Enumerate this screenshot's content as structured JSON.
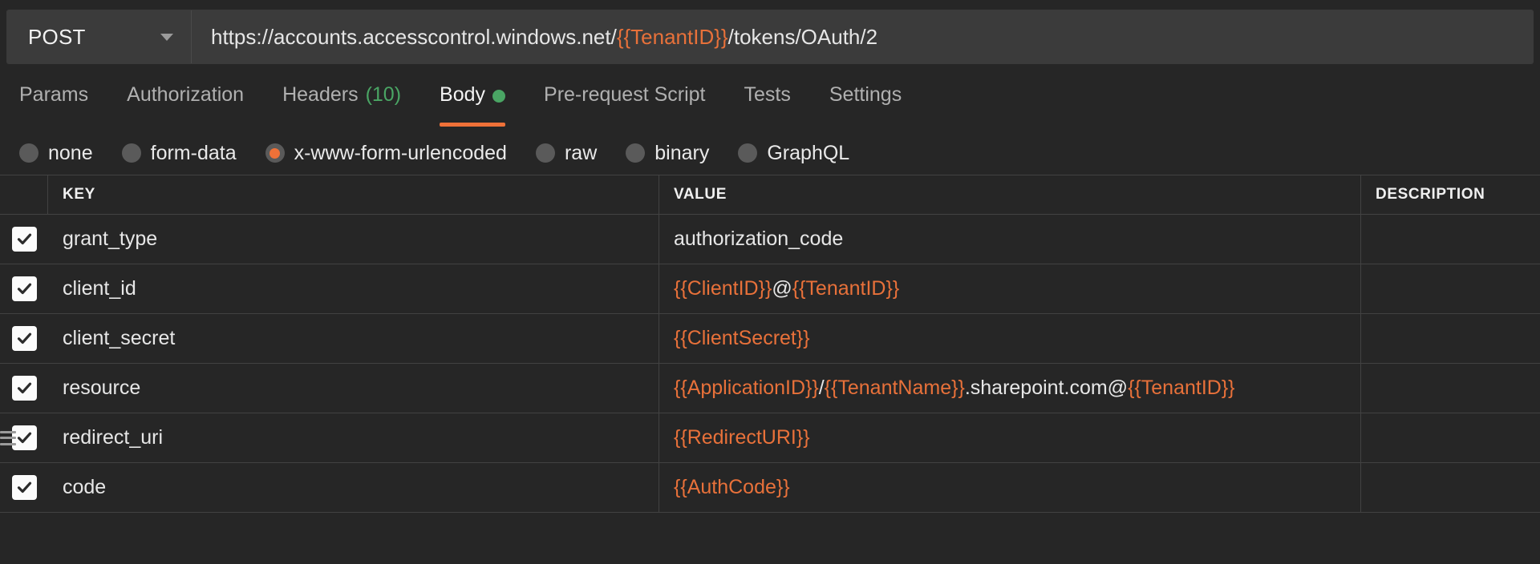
{
  "request": {
    "method": "POST",
    "method_caret_icon": "chevron-down-icon",
    "url_segments": [
      {
        "text": "https://accounts.accesscontrol.windows.net/",
        "variable": false
      },
      {
        "text": "{{TenantID}}",
        "variable": true
      },
      {
        "text": "/tokens/OAuth/2",
        "variable": false
      }
    ],
    "url_full": "https://accounts.accesscontrol.windows.net/{{TenantID}}/tokens/OAuth/2"
  },
  "tabs": [
    {
      "label": "Params",
      "active": false,
      "count": null,
      "dot": false
    },
    {
      "label": "Authorization",
      "active": false,
      "count": null,
      "dot": false
    },
    {
      "label": "Headers",
      "active": false,
      "count": "(10)",
      "dot": false
    },
    {
      "label": "Body",
      "active": true,
      "count": null,
      "dot": true
    },
    {
      "label": "Pre-request Script",
      "active": false,
      "count": null,
      "dot": false
    },
    {
      "label": "Tests",
      "active": false,
      "count": null,
      "dot": false
    },
    {
      "label": "Settings",
      "active": false,
      "count": null,
      "dot": false
    }
  ],
  "body_types": [
    {
      "label": "none",
      "selected": false
    },
    {
      "label": "form-data",
      "selected": false
    },
    {
      "label": "x-www-form-urlencoded",
      "selected": true
    },
    {
      "label": "raw",
      "selected": false
    },
    {
      "label": "binary",
      "selected": false
    },
    {
      "label": "GraphQL",
      "selected": false
    }
  ],
  "table": {
    "columns": [
      "KEY",
      "VALUE",
      "DESCRIPTION"
    ],
    "rows": [
      {
        "checked": true,
        "drag_handle": false,
        "key": "grant_type",
        "value_segments": [
          {
            "text": "authorization_code",
            "variable": false
          }
        ],
        "value_full": "authorization_code",
        "description": ""
      },
      {
        "checked": true,
        "drag_handle": false,
        "key": "client_id",
        "value_segments": [
          {
            "text": "{{ClientID}}",
            "variable": true
          },
          {
            "text": "@",
            "variable": false
          },
          {
            "text": "{{TenantID}}",
            "variable": true
          }
        ],
        "value_full": "{{ClientID}}@{{TenantID}}",
        "description": ""
      },
      {
        "checked": true,
        "drag_handle": false,
        "key": "client_secret",
        "value_segments": [
          {
            "text": "{{ClientSecret}}",
            "variable": true
          }
        ],
        "value_full": "{{ClientSecret}}",
        "description": ""
      },
      {
        "checked": true,
        "drag_handle": false,
        "key": "resource",
        "value_segments": [
          {
            "text": "{{ApplicationID}}",
            "variable": true
          },
          {
            "text": "/",
            "variable": false
          },
          {
            "text": "{{TenantName}}",
            "variable": true
          },
          {
            "text": ".sharepoint.com@",
            "variable": false
          },
          {
            "text": "{{TenantID}}",
            "variable": true
          }
        ],
        "value_full": "{{ApplicationID}}/{{TenantName}}.sharepoint.com@{{TenantID}}",
        "description": ""
      },
      {
        "checked": true,
        "drag_handle": true,
        "key": "redirect_uri",
        "value_segments": [
          {
            "text": "{{RedirectURI}}",
            "variable": true
          }
        ],
        "value_full": "{{RedirectURI}}",
        "description": ""
      },
      {
        "checked": true,
        "drag_handle": false,
        "key": "code",
        "value_segments": [
          {
            "text": "{{AuthCode}}",
            "variable": true
          }
        ],
        "value_full": "{{AuthCode}}",
        "description": ""
      }
    ]
  },
  "colors": {
    "background": "#262626",
    "field_background": "#3b3b3b",
    "variable_orange": "#e8713a",
    "accent_orange": "#ef7138",
    "indicator_green": "#4aa564",
    "border": "#424242",
    "text_primary": "#e7e7e7",
    "text_muted": "#b0b0b0"
  }
}
